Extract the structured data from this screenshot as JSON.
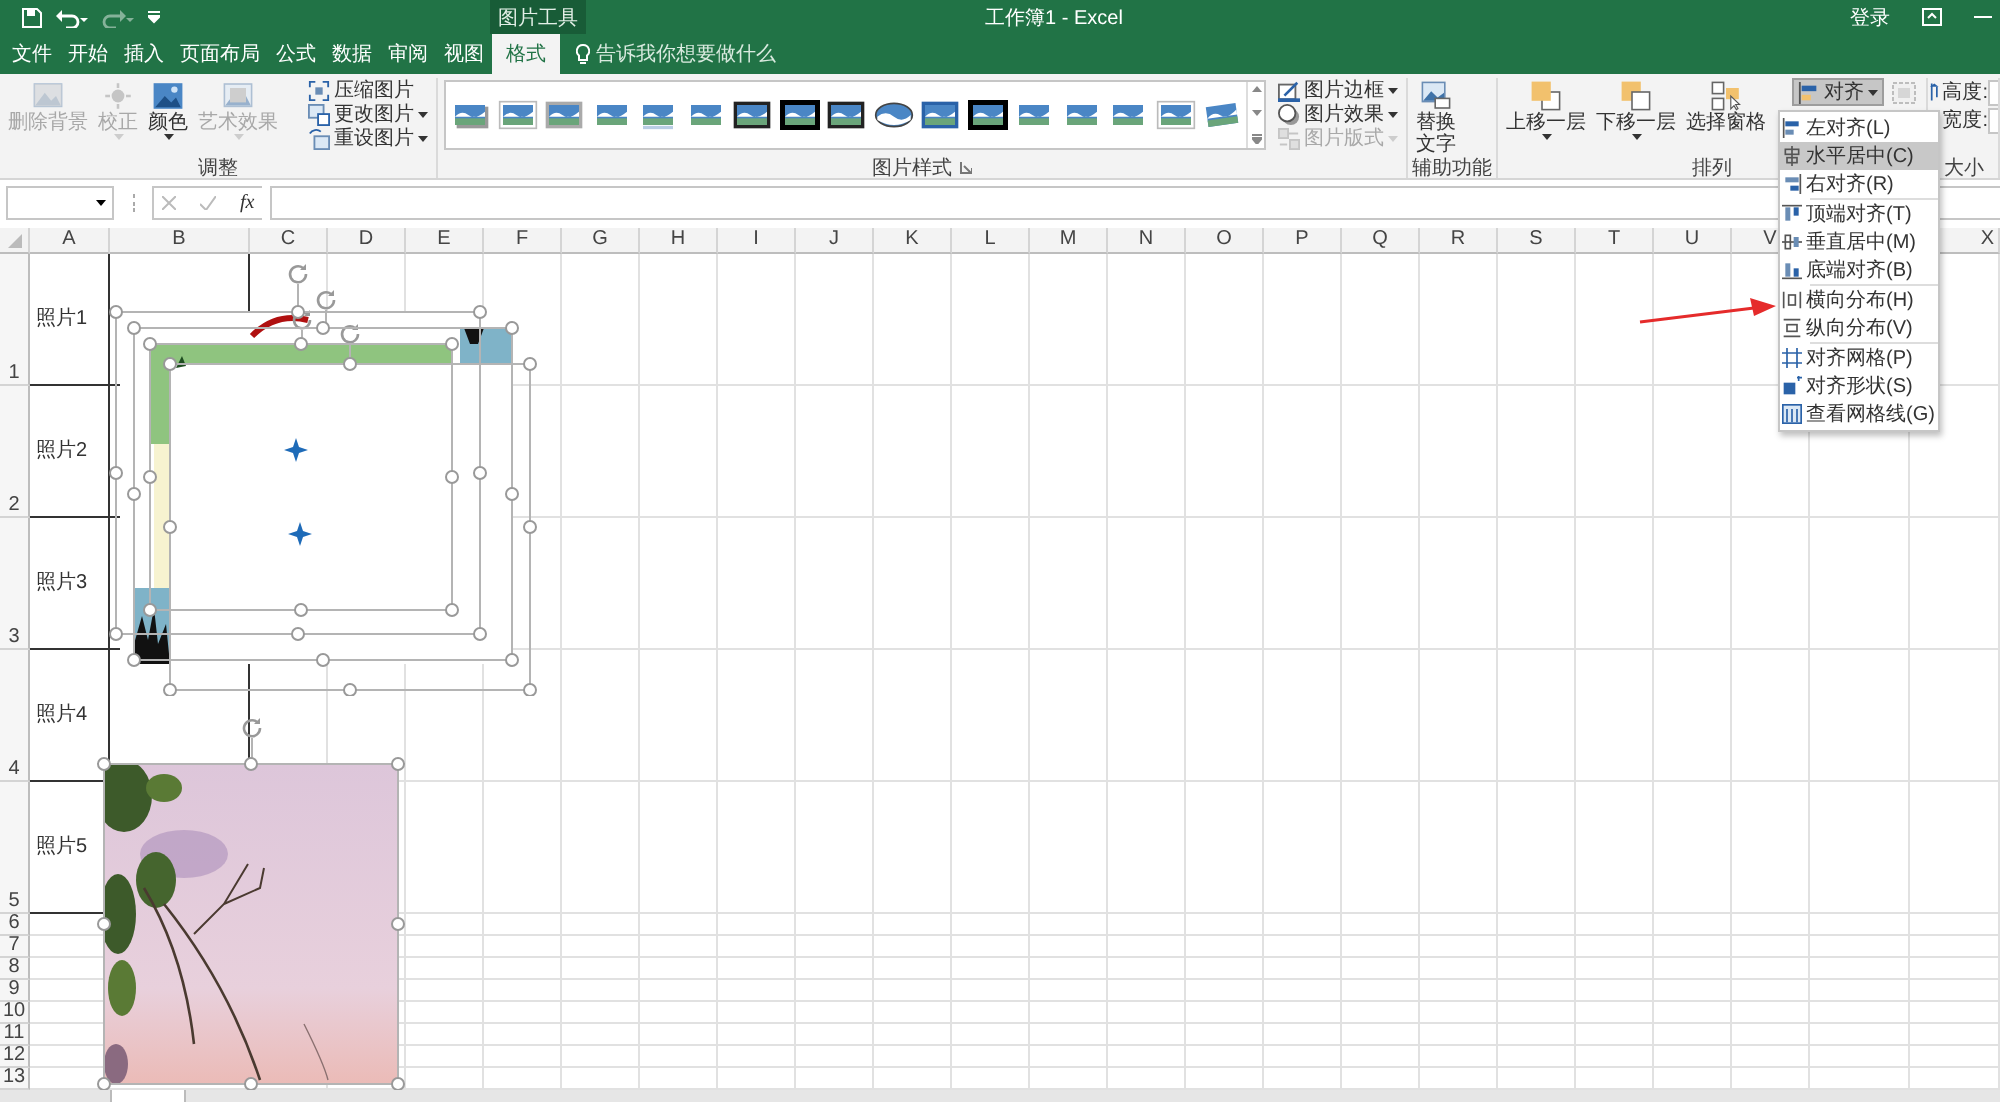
{
  "title_bar": {
    "context_label": "图片工具",
    "title": "工作簿1 - Excel",
    "sign_in": "登录"
  },
  "tabs": [
    {
      "label": "文件",
      "selected": false
    },
    {
      "label": "开始",
      "selected": false
    },
    {
      "label": "插入",
      "selected": false
    },
    {
      "label": "页面布局",
      "selected": false
    },
    {
      "label": "公式",
      "selected": false
    },
    {
      "label": "数据",
      "selected": false
    },
    {
      "label": "审阅",
      "selected": false
    },
    {
      "label": "视图",
      "selected": false
    },
    {
      "label": "格式",
      "selected": true
    }
  ],
  "tell_me": {
    "placeholder": "告诉我你想要做什么"
  },
  "ribbon": {
    "groups": [
      {
        "label": "调整",
        "launcher": false,
        "items": [
          {
            "kind": "large",
            "label": "删除背景",
            "disabled": true,
            "dropdown": false
          },
          {
            "kind": "large",
            "label": "校正",
            "disabled": true,
            "dropdown": true
          },
          {
            "kind": "large",
            "label": "颜色",
            "disabled": false,
            "dropdown": true
          },
          {
            "kind": "large",
            "label": "艺术效果",
            "disabled": true,
            "dropdown": true
          },
          {
            "kind": "stack",
            "items": [
              {
                "label": "压缩图片",
                "disabled": false,
                "dropdown": false,
                "pressed": false
              },
              {
                "label": "更改图片",
                "disabled": false,
                "dropdown": true,
                "pressed": false
              },
              {
                "label": "重设图片",
                "disabled": false,
                "dropdown": true,
                "pressed": false
              }
            ]
          }
        ]
      },
      {
        "label": "图片样式",
        "launcher": true,
        "items": [
          {
            "kind": "gallery"
          },
          {
            "kind": "stack",
            "items": [
              {
                "label": "图片边框",
                "disabled": false,
                "dropdown": true,
                "pressed": false
              },
              {
                "label": "图片效果",
                "disabled": false,
                "dropdown": true,
                "pressed": false
              },
              {
                "label": "图片版式",
                "disabled": true,
                "dropdown": true,
                "pressed": false
              }
            ]
          }
        ]
      },
      {
        "label": "辅助功能",
        "launcher": false,
        "items": [
          {
            "kind": "large",
            "label": "替换文字",
            "disabled": false,
            "dropdown": false
          }
        ]
      },
      {
        "label": "排列",
        "launcher": false,
        "items": [
          {
            "kind": "large",
            "label": "上移一层",
            "disabled": false,
            "dropdown": true
          },
          {
            "kind": "large",
            "label": "下移一层",
            "disabled": false,
            "dropdown": true
          },
          {
            "kind": "large",
            "label": "选择窗格",
            "disabled": false,
            "dropdown": false
          },
          {
            "kind": "stack",
            "items": [
              {
                "label": "对齐",
                "disabled": false,
                "dropdown": true,
                "pressed": true
              }
            ]
          },
          {
            "kind": "icon",
            "disabled": true
          }
        ]
      },
      {
        "label": "大小",
        "launcher": false,
        "items": [
          {
            "kind": "fields",
            "items": [
              {
                "label": "高度:"
              },
              {
                "label": "宽度:"
              }
            ]
          }
        ]
      }
    ]
  },
  "formula_bar": {
    "function_label": "fx"
  },
  "sheet": {
    "columns": [
      "A",
      "B",
      "C",
      "D",
      "E",
      "F",
      "G",
      "H",
      "I",
      "J",
      "K",
      "L",
      "M",
      "N",
      "O",
      "P",
      "Q",
      "R",
      "S",
      "T",
      "U",
      "V"
    ],
    "edge_column": "X",
    "rows": [
      {
        "header": "1",
        "label": "照片1"
      },
      {
        "header": "2",
        "label": "照片2"
      },
      {
        "header": "3",
        "label": "照片3"
      },
      {
        "header": "4",
        "label": "照片4"
      },
      {
        "header": "5",
        "label": "照片5"
      },
      {
        "header": "6"
      },
      {
        "header": "7"
      },
      {
        "header": "8"
      },
      {
        "header": "9"
      },
      {
        "header": "10"
      },
      {
        "header": "11"
      },
      {
        "header": "12"
      },
      {
        "header": "13"
      }
    ]
  },
  "align_menu": {
    "groups": [
      [
        {
          "label": "左对齐(L)",
          "selected": false
        },
        {
          "label": "水平居中(C)",
          "selected": true
        },
        {
          "label": "右对齐(R)",
          "selected": false
        }
      ],
      [
        {
          "label": "顶端对齐(T)",
          "selected": false
        },
        {
          "label": "垂直居中(M)",
          "selected": false
        },
        {
          "label": "底端对齐(B)",
          "selected": false
        }
      ],
      [
        {
          "label": "横向分布(H)",
          "selected": false
        },
        {
          "label": "纵向分布(V)",
          "selected": false
        }
      ],
      [
        {
          "label": "对齐网格(P)",
          "selected": false
        },
        {
          "label": "对齐形状(S)",
          "selected": false
        },
        {
          "label": "查看网格线(G)",
          "selected": false
        }
      ]
    ]
  }
}
